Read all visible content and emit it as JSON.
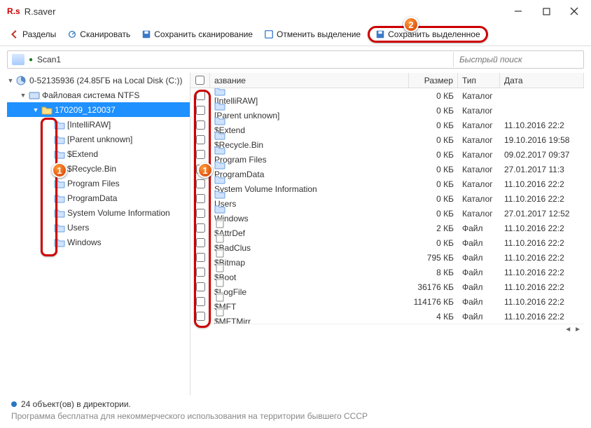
{
  "window": {
    "logo": "R.s",
    "title": "R.saver"
  },
  "toolbar": {
    "sections": "Разделы",
    "scan": "Сканировать",
    "save_scan": "Сохранить сканирование",
    "cancel_sel": "Отменить выделение",
    "save_sel": "Сохранить выделенное"
  },
  "markers": {
    "m1": "1",
    "m2": "2"
  },
  "pathbar": {
    "path": "Scan1",
    "search_placeholder": "Быстрый поиск"
  },
  "tree": {
    "root": "0-52135936 (24.85ГБ на Local Disk (C:))",
    "fs": "Файловая система NTFS",
    "scan_folder": "170209_120037",
    "children": [
      "[IntelliRAW]",
      "[Parent unknown]",
      "$Extend",
      "$Recycle.Bin",
      "Program Files",
      "ProgramData",
      "System Volume Information",
      "Users",
      "Windows"
    ]
  },
  "columns": {
    "name": "азвание",
    "size": "Размер",
    "type": "Тип",
    "date": "Дата"
  },
  "rows": [
    {
      "name": "[IntelliRAW]",
      "size": "0 КБ",
      "type": "Каталог",
      "date": "",
      "kind": "folder"
    },
    {
      "name": "[Parent unknown]",
      "size": "0 КБ",
      "type": "Каталог",
      "date": "",
      "kind": "folder"
    },
    {
      "name": "$Extend",
      "size": "0 КБ",
      "type": "Каталог",
      "date": "11.10.2016 22:2",
      "kind": "folder"
    },
    {
      "name": "$Recycle.Bin",
      "size": "0 КБ",
      "type": "Каталог",
      "date": "19.10.2016 19:58",
      "kind": "folder"
    },
    {
      "name": "Program Files",
      "size": "0 КБ",
      "type": "Каталог",
      "date": "09.02.2017 09:37",
      "kind": "folder"
    },
    {
      "name": "ProgramData",
      "size": "0 КБ",
      "type": "Каталог",
      "date": "27.01.2017 11:3",
      "kind": "folder"
    },
    {
      "name": "System Volume Information",
      "size": "0 КБ",
      "type": "Каталог",
      "date": "11.10.2016 22:2",
      "kind": "folder"
    },
    {
      "name": "Users",
      "size": "0 КБ",
      "type": "Каталог",
      "date": "11.10.2016 22:2",
      "kind": "folder"
    },
    {
      "name": "Windows",
      "size": "0 КБ",
      "type": "Каталог",
      "date": "27.01.2017 12:52",
      "kind": "folder"
    },
    {
      "name": "$AttrDef",
      "size": "2 КБ",
      "type": "Файл",
      "date": "11.10.2016 22:2",
      "kind": "file"
    },
    {
      "name": "$BadClus",
      "size": "0 КБ",
      "type": "Файл",
      "date": "11.10.2016 22:2",
      "kind": "file"
    },
    {
      "name": "$Bitmap",
      "size": "795 КБ",
      "type": "Файл",
      "date": "11.10.2016 22:2",
      "kind": "file"
    },
    {
      "name": "$Boot",
      "size": "8 КБ",
      "type": "Файл",
      "date": "11.10.2016 22:2",
      "kind": "file"
    },
    {
      "name": "$LogFile",
      "size": "36176 КБ",
      "type": "Файл",
      "date": "11.10.2016 22:2",
      "kind": "file"
    },
    {
      "name": "$MFT",
      "size": "114176 КБ",
      "type": "Файл",
      "date": "11.10.2016 22:2",
      "kind": "file"
    },
    {
      "name": "$MFTMirr",
      "size": "4 КБ",
      "type": "Файл",
      "date": "11.10.2016 22:2",
      "kind": "file"
    }
  ],
  "status": "24 объект(ов) в директории.",
  "footer": "Программа бесплатна для некоммерческого использования на территории бывшего СССР"
}
